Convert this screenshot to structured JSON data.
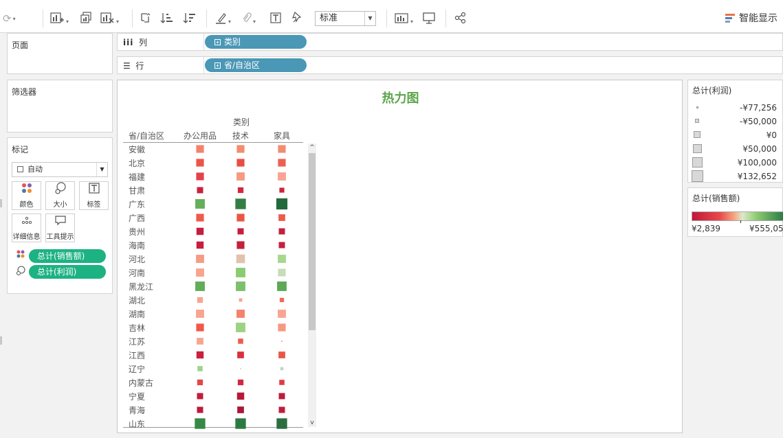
{
  "toolbar": {
    "fit_value": "标准",
    "show_me_label": "智能显示",
    "icons": [
      "bar-add-icon",
      "undo-redo-icon",
      "new-chart-icon",
      "duplicate-icon",
      "clear-icon",
      "swap-icon",
      "sort-asc-icon",
      "sort-desc-icon",
      "highlight-icon",
      "paperclip-icon",
      "label-icon",
      "pin-icon",
      "presentation-icon",
      "share-icon"
    ]
  },
  "panels": {
    "pages": "页面",
    "filters": "筛选器",
    "marks": "标记",
    "marks_type": "自动",
    "cards": [
      "颜色",
      "大小",
      "标签",
      "详细信息",
      "工具提示"
    ],
    "pill_color": "总计(销售额)",
    "pill_size": "总计(利润)"
  },
  "shelves": {
    "columns_label": "列",
    "rows_label": "行",
    "columns_field": "类别",
    "rows_field": "省/自治区"
  },
  "view": {
    "title": "热力图",
    "column_header_title": "类别",
    "row_header_title": "省/自治区",
    "columns": [
      "办公用品",
      "技术",
      "家具"
    ],
    "rows": [
      "安徽",
      "北京",
      "福建",
      "甘肃",
      "广东",
      "广西",
      "贵州",
      "海南",
      "河北",
      "河南",
      "黑龙江",
      "湖北",
      "湖南",
      "吉林",
      "江苏",
      "江西",
      "辽宁",
      "内蒙古",
      "宁夏",
      "青海",
      "山东"
    ]
  },
  "chart_data": {
    "type": "heatmap",
    "title": "热力图",
    "xlabel": "类别",
    "ylabel": "省/自治区",
    "categories": [
      "办公用品",
      "技术",
      "家具"
    ],
    "rows": [
      "安徽",
      "北京",
      "福建",
      "甘肃",
      "广东",
      "广西",
      "贵州",
      "海南",
      "河北",
      "河南",
      "黑龙江",
      "湖北",
      "湖南",
      "吉林",
      "江苏",
      "江西",
      "辽宁",
      "内蒙古",
      "宁夏",
      "青海",
      "山东"
    ],
    "color_measure": "总计(销售额)",
    "size_measure": "总计(利润)",
    "cells": [
      {
        "color": "#f4826a",
        "size": 0.62
      },
      {
        "color": "#f38b70",
        "size": 0.62
      },
      {
        "color": "#f38b70",
        "size": 0.62
      },
      {
        "color": "#ea5545",
        "size": 0.62
      },
      {
        "color": "#e84e43",
        "size": 0.62
      },
      {
        "color": "#ec6051",
        "size": 0.62
      },
      {
        "color": "#e4424a",
        "size": 0.62
      },
      {
        "color": "#f59b84",
        "size": 0.66
      },
      {
        "color": "#f7a592",
        "size": 0.66
      },
      {
        "color": "#c7223f",
        "size": 0.5
      },
      {
        "color": "#d1283f",
        "size": 0.46
      },
      {
        "color": "#cc253f",
        "size": 0.4
      },
      {
        "color": "#65ae5a",
        "size": 0.77
      },
      {
        "color": "#347e45",
        "size": 0.85
      },
      {
        "color": "#236a3b",
        "size": 0.9
      },
      {
        "color": "#ee5a4b",
        "size": 0.62
      },
      {
        "color": "#ea5545",
        "size": 0.62
      },
      {
        "color": "#ec5b4b",
        "size": 0.54
      },
      {
        "color": "#c41e3e",
        "size": 0.58
      },
      {
        "color": "#c61e3d",
        "size": 0.5
      },
      {
        "color": "#c4213f",
        "size": 0.5
      },
      {
        "color": "#c51e3e",
        "size": 0.58
      },
      {
        "color": "#c4213f",
        "size": 0.62
      },
      {
        "color": "#c4213f",
        "size": 0.5
      },
      {
        "color": "#f59c86",
        "size": 0.66
      },
      {
        "color": "#e2c2ad",
        "size": 0.7
      },
      {
        "color": "#a6d88e",
        "size": 0.66
      },
      {
        "color": "#f7a591",
        "size": 0.66
      },
      {
        "color": "#8acb73",
        "size": 0.77
      },
      {
        "color": "#c8dcb8",
        "size": 0.62
      },
      {
        "color": "#63ac59",
        "size": 0.77
      },
      {
        "color": "#7cc06a",
        "size": 0.77
      },
      {
        "color": "#5ca855",
        "size": 0.77
      },
      {
        "color": "#f7a591",
        "size": 0.46
      },
      {
        "color": "#f4a591",
        "size": 0.27
      },
      {
        "color": "#f06956",
        "size": 0.35
      },
      {
        "color": "#f7a591",
        "size": 0.66
      },
      {
        "color": "#f4836c",
        "size": 0.66
      },
      {
        "color": "#f7a692",
        "size": 0.66
      },
      {
        "color": "#f0584a",
        "size": 0.62
      },
      {
        "color": "#9cd282",
        "size": 0.77
      },
      {
        "color": "#f59982",
        "size": 0.62
      },
      {
        "color": "#f7a591",
        "size": 0.54
      },
      {
        "color": "#ef5b4d",
        "size": 0.42
      },
      {
        "color": "#f39a88",
        "size": 0.1
      },
      {
        "color": "#c8203f",
        "size": 0.58
      },
      {
        "color": "#d92f40",
        "size": 0.54
      },
      {
        "color": "#ea5545",
        "size": 0.54
      },
      {
        "color": "#9fd38b",
        "size": 0.42
      },
      {
        "color": "#f0a896",
        "size": 0.08
      },
      {
        "color": "#c8cfc8",
        "size": 0.25
      },
      {
        "color": "#e04846",
        "size": 0.46
      },
      {
        "color": "#cd2a40",
        "size": 0.46
      },
      {
        "color": "#de3c44",
        "size": 0.42
      },
      {
        "color": "#c21c3d",
        "size": 0.5
      },
      {
        "color": "#b7183a",
        "size": 0.58
      },
      {
        "color": "#bd1c3c",
        "size": 0.5
      },
      {
        "color": "#bb1a3c",
        "size": 0.5
      },
      {
        "color": "#a8183a",
        "size": 0.54
      },
      {
        "color": "#c21c3d",
        "size": 0.5
      },
      {
        "color": "#378845",
        "size": 0.85
      },
      {
        "color": "#2c7a43",
        "size": 0.85
      },
      {
        "color": "#2b6e3f",
        "size": 0.85
      }
    ]
  },
  "legends": {
    "size_title": "总计(利润)",
    "size_items": [
      "-¥77,256",
      "-¥50,000",
      "¥0",
      "¥50,000",
      "¥100,000",
      "¥132,652"
    ],
    "size_values": [
      -77256,
      -50000,
      0,
      50000,
      100000,
      132652
    ],
    "color_title": "总计(销售额)",
    "color_min": "¥2,839",
    "color_max": "¥555,05"
  }
}
